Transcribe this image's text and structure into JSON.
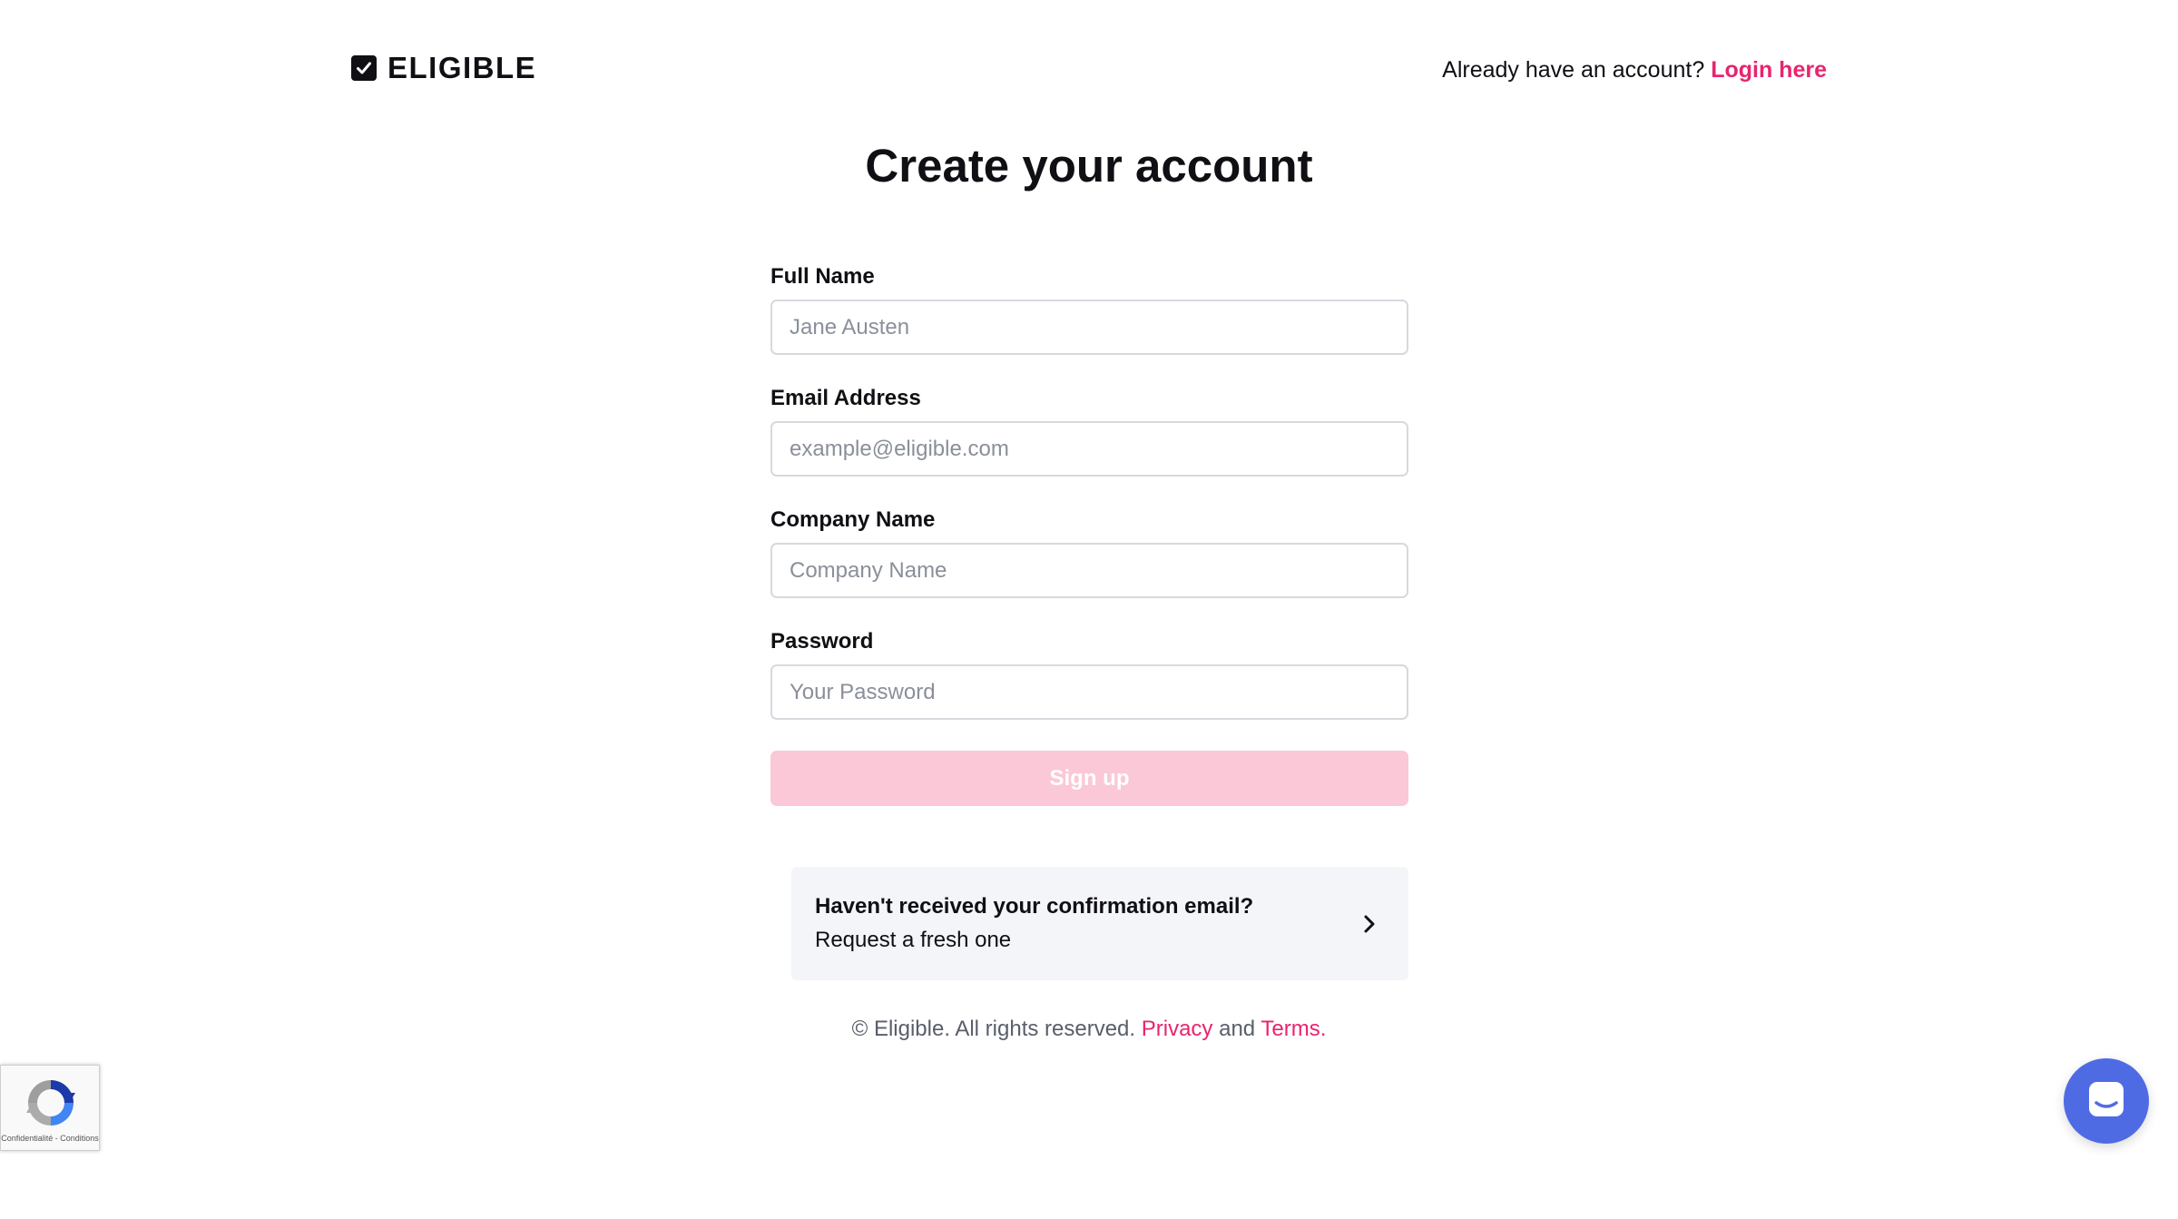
{
  "brand": {
    "name": "ELIGIBLE",
    "logo_icon": "checkbox-icon"
  },
  "header": {
    "prompt": "Already have an account?",
    "login_link": "Login here"
  },
  "page": {
    "title": "Create your account"
  },
  "form": {
    "fields": [
      {
        "label": "Full Name",
        "placeholder": "Jane Austen",
        "value": ""
      },
      {
        "label": "Email Address",
        "placeholder": "example@eligible.com",
        "value": ""
      },
      {
        "label": "Company Name",
        "placeholder": "Company Name",
        "value": ""
      },
      {
        "label": "Password",
        "placeholder": "Your Password",
        "value": ""
      }
    ],
    "submit_label": "Sign up"
  },
  "confirmation": {
    "title": "Haven't received your confirmation email?",
    "subtitle": "Request a fresh one",
    "icon": "chevron-right-icon"
  },
  "footer": {
    "copyright": "© Eligible. All rights reserved.",
    "privacy": "Privacy",
    "and": "and",
    "terms": "Terms",
    "period": "."
  },
  "recaptcha": {
    "text": "Confidentialité - Conditions",
    "icon": "recaptcha-icon"
  },
  "chat": {
    "icon": "chat-icon"
  },
  "colors": {
    "accent": "#e8246f",
    "button_disabled": "#fbc8d7",
    "chat": "#4f6be4",
    "card_bg": "#f4f5f8"
  }
}
